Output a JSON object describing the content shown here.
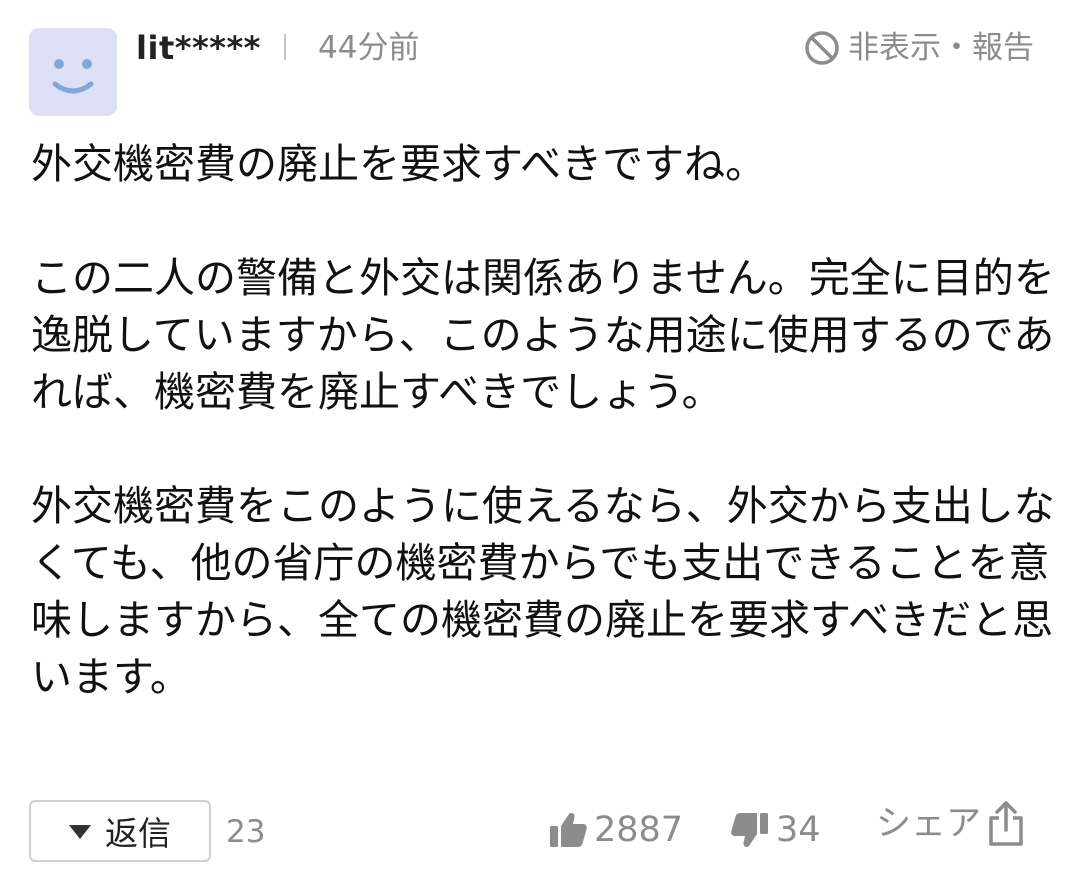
{
  "comment": {
    "avatar_icon": "smiley-face-icon",
    "avatar_color": "#dde0f4",
    "user_name": "lit*****",
    "separator": "|",
    "time_ago": "44分前",
    "hide_report_label": "非表示・報告",
    "paragraphs": [
      "外交機密費の廃止を要求すべきですね。",
      "この二人の警備と外交は関係ありません。完全に目的を逸脱していますから、このような用途に使用するのであれば、機密費を廃止すべきでしょう。",
      "外交機密費をこのように使えるなら、外交から支出しなくても、他の省庁の機密費からでも支出できることを意味しますから、全ての機密費の廃止を要求すべきだと思います。"
    ]
  },
  "footer": {
    "reply_label": "返信",
    "reply_count": "23",
    "like_count": "2887",
    "dislike_count": "34",
    "share_label": "シェア",
    "accent_gray": "#8c8c8c"
  }
}
